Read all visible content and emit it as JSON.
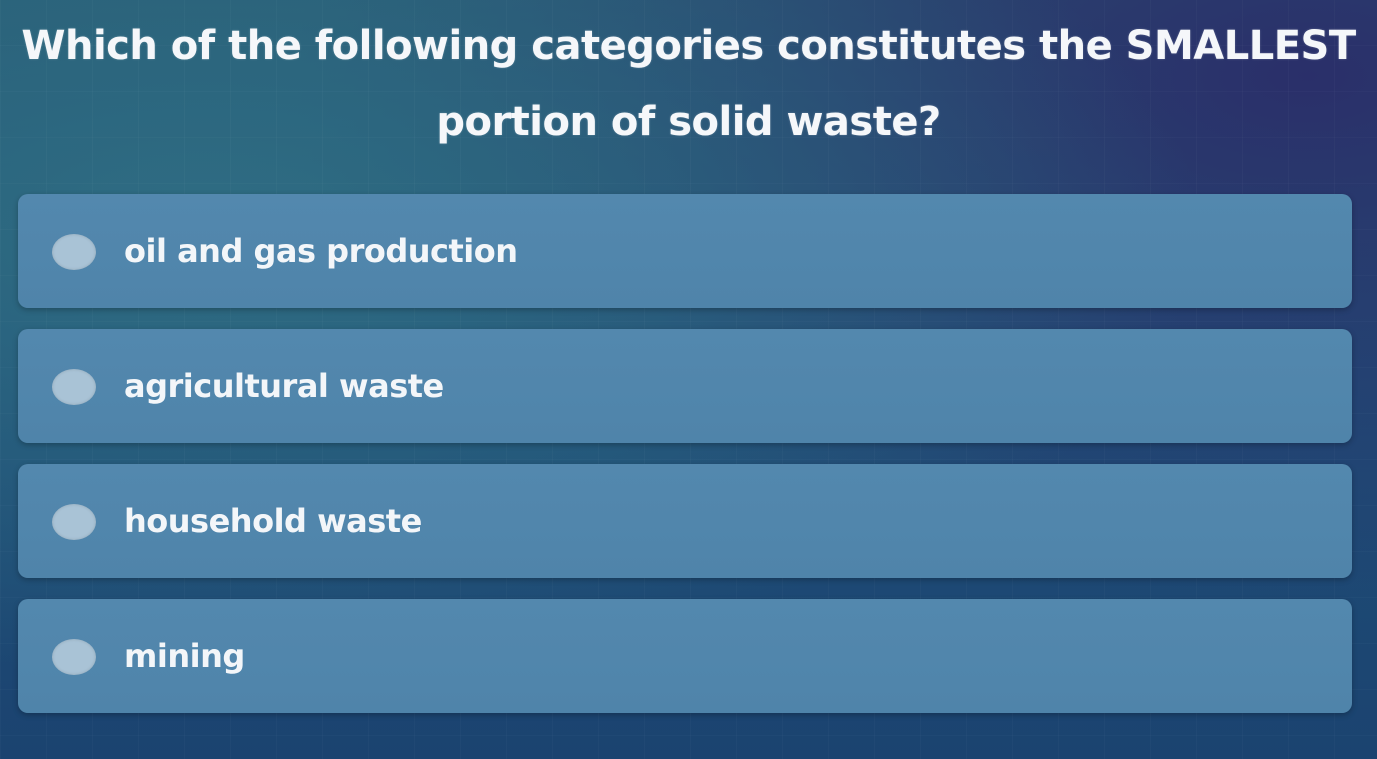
{
  "quiz": {
    "question": "Which of the following categories constitutes the SMALLEST portion of solid waste?",
    "options": [
      {
        "label": "oil and gas production"
      },
      {
        "label": "agricultural waste"
      },
      {
        "label": "household waste"
      },
      {
        "label": "mining"
      }
    ]
  },
  "icons": {
    "radio": "radio-unselected-icon"
  },
  "colors": {
    "background": "#22557a",
    "option_background": "#5186ac",
    "radio_fill": "#a9c3d6",
    "text": "#f3f6f9"
  }
}
